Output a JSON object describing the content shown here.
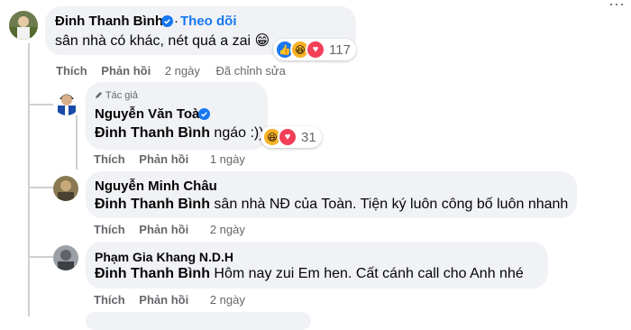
{
  "comments": [
    {
      "author": "Đinh Thanh Bình",
      "verified": true,
      "follow_label": "Theo dõi",
      "text": "sân nhà có khác, nét quá a zai",
      "emoji": "😁",
      "reactions": [
        "like-icon",
        "haha-icon",
        "love-icon"
      ],
      "reaction_count": "117",
      "actions": {
        "like": "Thích",
        "reply": "Phản hồi"
      },
      "time": "2 ngày",
      "edited": "Đã chỉnh sửa",
      "more": "···"
    },
    {
      "badge": "Tác giả",
      "author": "Nguyễn Văn Toàn",
      "verified": true,
      "mention": "Đinh Thanh Bình",
      "text": " ngáo :))",
      "reactions": [
        "haha-icon",
        "love-icon"
      ],
      "reaction_count": "31",
      "actions": {
        "like": "Thích",
        "reply": "Phản hồi"
      },
      "time": "1 ngày"
    },
    {
      "author": "Nguyễn Minh Châu",
      "mention": "Đinh Thanh Bình",
      "text": " sân nhà NĐ của Toàn. Tiện ký luôn công bố luôn nhanh",
      "actions": {
        "like": "Thích",
        "reply": "Phản hồi"
      },
      "time": "2 ngày"
    },
    {
      "author": "Phạm Gia Khang N.D.H",
      "mention": "Đinh Thanh Bình",
      "text": " Hôm nay zui Em hen. Cất cánh call cho Anh nhé",
      "actions": {
        "like": "Thích",
        "reply": "Phản hồi"
      },
      "time": "2 ngày"
    }
  ],
  "colors": {
    "link": "#1877f2",
    "bubble": "#f0f2f5",
    "secondary": "#65676b"
  }
}
